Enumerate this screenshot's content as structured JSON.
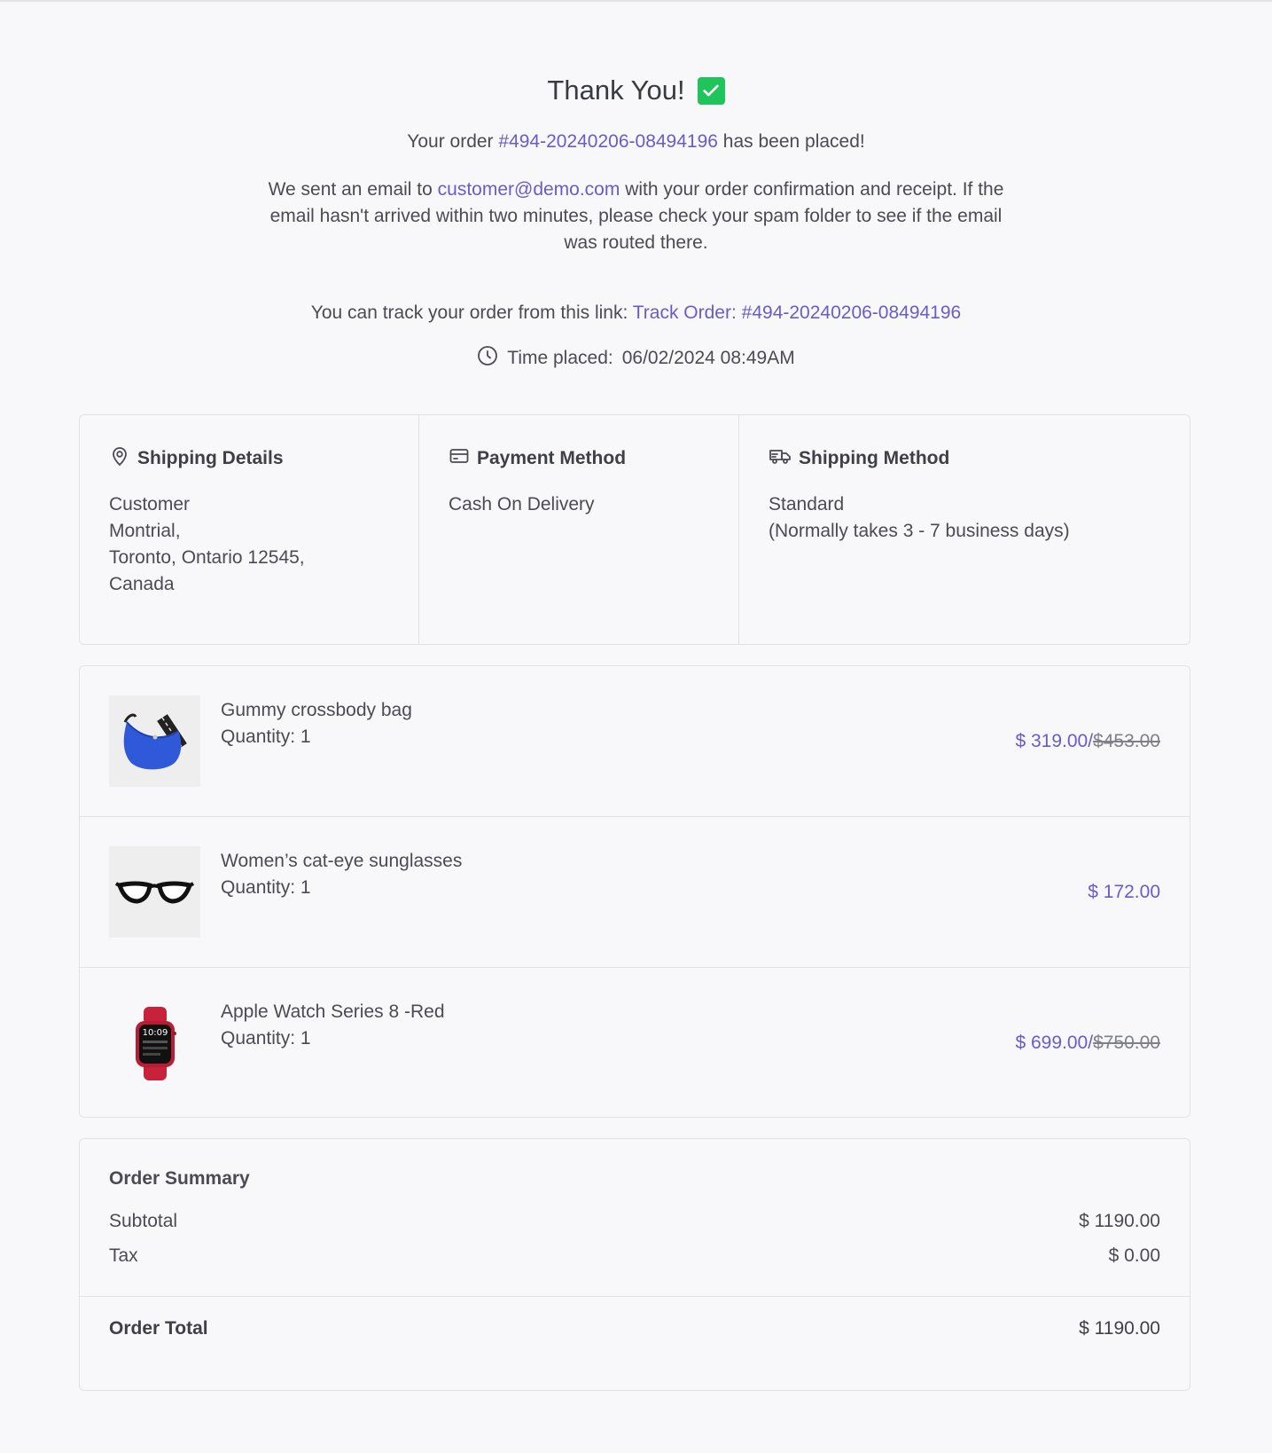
{
  "hero": {
    "title": "Thank You!",
    "order_prefix": "Your order ",
    "order_id": "#494-20240206-08494196",
    "order_suffix": " has been placed!",
    "email_prefix": "We sent an email to ",
    "email": "customer@demo.com",
    "email_suffix": " with your order confirmation and receipt. If the email hasn't arrived within two minutes, please check your spam folder to see if the email was routed there.",
    "track_prefix": "You can track your order from this link: ",
    "track_link": "Track Order: #494-20240206-08494196",
    "time_label": "Time placed:",
    "time_value": "06/02/2024 08:49AM"
  },
  "shipping_details": {
    "heading": "Shipping Details",
    "lines": [
      "Customer",
      "Montrial,",
      "Toronto, Ontario 12545,",
      "Canada"
    ]
  },
  "payment_method": {
    "heading": "Payment Method",
    "value": "Cash On Delivery"
  },
  "shipping_method": {
    "heading": "Shipping Method",
    "value": "Standard",
    "note": "(Normally takes 3 - 7 business days)"
  },
  "items": [
    {
      "name": "Gummy crossbody bag",
      "quantity": "Quantity: 1",
      "price": "$ 319.00",
      "old_price": "$453.00"
    },
    {
      "name": "Women’s cat-eye sunglasses",
      "quantity": "Quantity: 1",
      "price": "$ 172.00",
      "old_price": ""
    },
    {
      "name": "Apple Watch Series 8 -Red",
      "quantity": "Quantity: 1",
      "price": "$ 699.00",
      "old_price": "$750.00"
    }
  ],
  "summary": {
    "heading": "Order Summary",
    "subtotal_label": "Subtotal",
    "subtotal_value": "$ 1190.00",
    "tax_label": "Tax",
    "tax_value": "$ 0.00",
    "total_label": "Order Total",
    "total_value": "$ 1190.00"
  },
  "colors": {
    "accent": "#6a5cc8",
    "check": "#1fc55a",
    "background": "#f8f8fa"
  },
  "icons": {
    "title": "check-square-icon",
    "time": "clock-icon",
    "shipping_details": "map-pin-icon",
    "payment_method": "credit-card-icon",
    "shipping_method": "truck-icon"
  }
}
